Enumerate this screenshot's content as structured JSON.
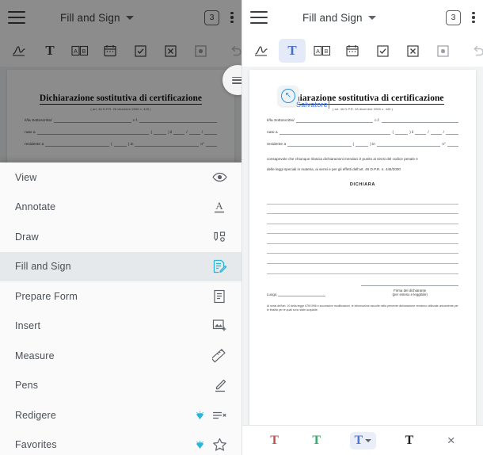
{
  "app": {
    "title": "Fill and Sign",
    "page_badge": "3",
    "menu_icon": "hamburger-icon",
    "overflow_icon": "kebab-menu-icon",
    "chevron_icon": "chevron-down-icon"
  },
  "toolbar": {
    "tools": [
      {
        "name": "signature-tool",
        "glyph": "signature",
        "selected": false
      },
      {
        "name": "text-tool",
        "glyph": "T",
        "selected": true
      },
      {
        "name": "combo-text-tool",
        "glyph": "AB",
        "selected": false
      },
      {
        "name": "date-tool",
        "glyph": "calendar",
        "selected": false
      },
      {
        "name": "checkmark-tool",
        "glyph": "check-box",
        "selected": false
      },
      {
        "name": "cross-tool",
        "glyph": "cross-box",
        "selected": false
      },
      {
        "name": "dot-tool",
        "glyph": "dot-box",
        "selected": false
      },
      {
        "name": "undo-tool",
        "glyph": "undo",
        "selected": false
      }
    ],
    "toolbar_selected_left": "none",
    "toolbar_selected_right": "text-tool"
  },
  "menu": {
    "items": [
      {
        "label": "View",
        "icon": "eye-icon",
        "premium": false,
        "active": false
      },
      {
        "label": "Annotate",
        "icon": "text-underline-icon",
        "premium": false,
        "active": false
      },
      {
        "label": "Draw",
        "icon": "draw-tools-icon",
        "premium": false,
        "active": false
      },
      {
        "label": "Fill and Sign",
        "icon": "fill-sign-icon",
        "premium": false,
        "active": true
      },
      {
        "label": "Prepare Form",
        "icon": "form-icon",
        "premium": false,
        "active": false
      },
      {
        "label": "Insert",
        "icon": "insert-image-icon",
        "premium": false,
        "active": false
      },
      {
        "label": "Measure",
        "icon": "ruler-icon",
        "premium": false,
        "active": false
      },
      {
        "label": "Pens",
        "icon": "pen-icon",
        "premium": false,
        "active": false
      },
      {
        "label": "Redigere",
        "icon": "redact-icon",
        "premium": true,
        "active": false
      },
      {
        "label": "Favorites",
        "icon": "star-icon",
        "premium": true,
        "active": false
      }
    ]
  },
  "document": {
    "title": "Dichiarazione sostitutiva di certificazione",
    "subtitle": "( art. 46 D.P.R. 28 dicembre 2000 n. 445 )",
    "fields": [
      {
        "label": "Il/la Sottoscritto/",
        "label2": "c.f."
      },
      {
        "label": "nato a"
      },
      {
        "label": "residente a",
        "label2": "in",
        "label3": "n°"
      }
    ],
    "paragraph1": "consapevole che chiunque rilascia dichiarazioni mendaci è punito ai sensi del codice penale e",
    "paragraph2": "delle leggi speciali in materia, ai sensi e per gli effetti dell'art. 46 D.P.R. n. 445/2000",
    "dichiara": "DICHIARA",
    "place_label": "Luogo,",
    "signature_line1": "Firma del dichiarante",
    "signature_line2": "(per esteso e leggibile)",
    "footnote": "Ai sensi dell'art. 10 della legge 675/1996 e successive modificazioni, le informazioni raccolte nella presente dichiarazione verranno utilizzate unicamente per le finalità per le quali sono state acquisite.",
    "annotation_text": "Salvatore",
    "annotation_color": "#3b78e7",
    "handle_icon": "move-resize-icon"
  },
  "format_bar": {
    "buttons": [
      {
        "name": "text-color-red",
        "glyph": "T",
        "color": "#c0504d",
        "selected": false,
        "has_chevron": false
      },
      {
        "name": "text-color-green",
        "glyph": "T",
        "color": "#3aa86c",
        "selected": false,
        "has_chevron": false
      },
      {
        "name": "text-color-blue",
        "glyph": "T",
        "color": "#4a78d0",
        "selected": true,
        "has_chevron": true
      },
      {
        "name": "text-color-black",
        "glyph": "T",
        "color": "#1f1f1f",
        "selected": false,
        "has_chevron": false
      },
      {
        "name": "close-format-bar",
        "glyph": "×",
        "color": "#6b7075",
        "selected": false,
        "has_chevron": false
      }
    ]
  },
  "colors": {
    "accent": "#2f8fd6",
    "premium_gem": "#29b6d8",
    "selected_tool_bg": "#e4eaf7",
    "menu_active_bg": "#e6e9ec",
    "scrim": "rgba(0,0,0,0.45)"
  }
}
